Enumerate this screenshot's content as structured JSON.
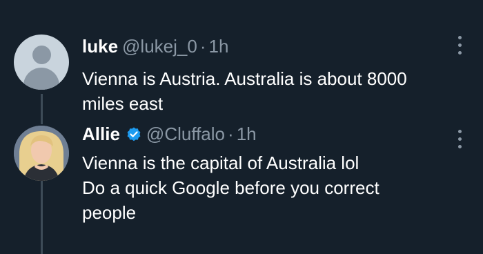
{
  "tweets": [
    {
      "name": "luke",
      "handle": "@lukej_0",
      "separator": "·",
      "time": "1h",
      "verified": false,
      "avatar_icon": "default-profile-icon",
      "lines": [
        "Vienna is Austria. Australia is about 8000",
        "miles east"
      ]
    },
    {
      "name": "Allie",
      "handle": "@Cluffalo",
      "separator": "·",
      "time": "1h",
      "verified": true,
      "verified_icon": "verified-badge-icon",
      "verified_color": "#1d9bf0",
      "avatar_icon": "profile-photo",
      "lines": [
        "Vienna is the capital of Australia lol",
        "Do a quick Google before you correct",
        "people"
      ]
    }
  ],
  "colors": {
    "background": "#15202b",
    "text": "#ffffff",
    "secondary": "#8b98a5",
    "thread_line": "#3d4b57",
    "accent": "#1d9bf0"
  }
}
